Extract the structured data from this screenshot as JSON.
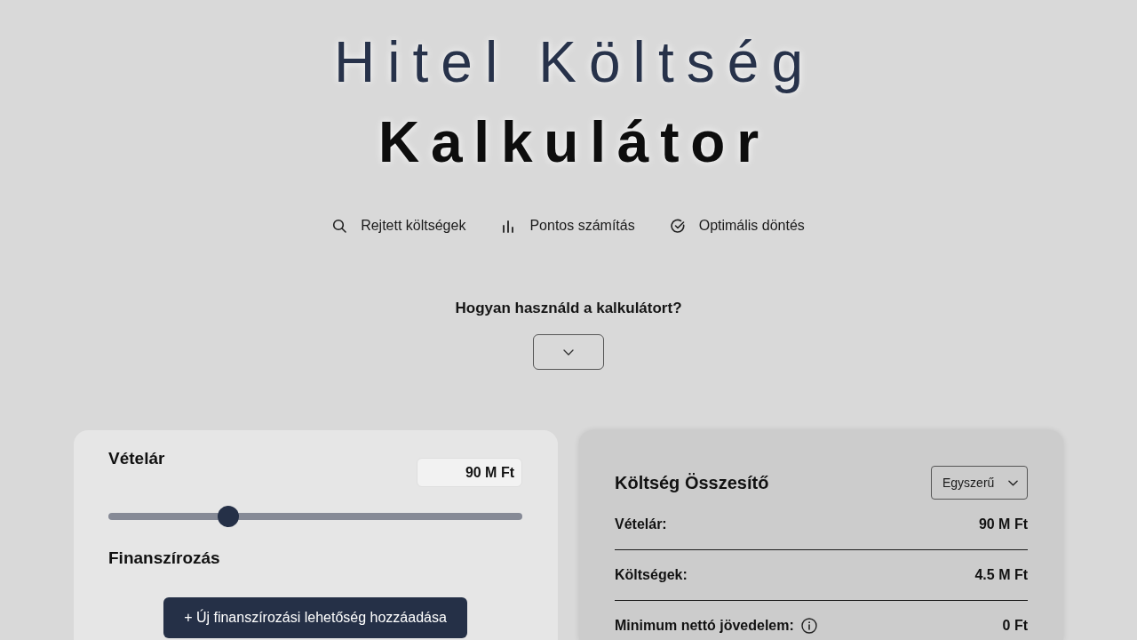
{
  "title": {
    "line_1": "Hitel Költség",
    "line_2": "Kalkulátor"
  },
  "features": [
    {
      "label": "Rejtett költségek"
    },
    {
      "label": "Pontos számítás"
    },
    {
      "label": "Optimális döntés"
    }
  ],
  "help": {
    "question": "Hogyan használd a kalkulátort?",
    "expanded": false
  },
  "purchase_panel": {
    "price": {
      "label": "Vételár",
      "value": "90 M Ft",
      "level": 0.29
    },
    "financing": {
      "label": "Finanszírozás",
      "add_button": "+ Új finanszírozási lehetőség hozzáadása"
    }
  },
  "summary_panel": {
    "title": "Költség Összesítő",
    "view_select": {
      "value": "Egyszerű"
    },
    "rows": [
      {
        "label": "Vételár:",
        "value": "90 M Ft",
        "info": false
      },
      {
        "label": "Költségek:",
        "value": "4.5 M Ft",
        "info": false
      },
      {
        "label": "Minimum nettó jövedelem:",
        "value": "0 Ft",
        "info": true
      }
    ]
  }
}
